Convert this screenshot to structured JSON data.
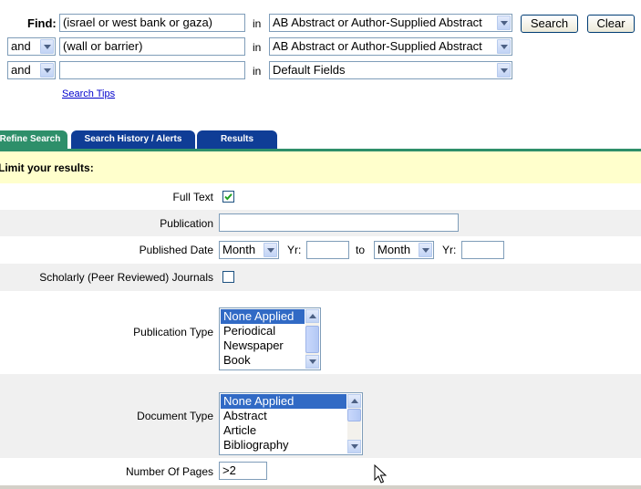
{
  "search": {
    "find_label": "Find:",
    "rows": [
      {
        "op": "",
        "value": "(israel or west bank or gaza)",
        "in_label": "in",
        "field": "AB Abstract or Author-Supplied Abstract"
      },
      {
        "op": "and",
        "value": "(wall or barrier)",
        "in_label": "in",
        "field": "AB Abstract or Author-Supplied Abstract"
      },
      {
        "op": "and",
        "value": "",
        "in_label": "in",
        "field": "Default Fields"
      }
    ],
    "search_button": "Search",
    "clear_button": "Clear",
    "tips_link": "Search Tips"
  },
  "tabs": [
    {
      "label": "Refine Search",
      "active": true
    },
    {
      "label": "Search History / Alerts",
      "active": false
    },
    {
      "label": "Results",
      "active": false
    }
  ],
  "limits": {
    "header": "Limit your results:",
    "full_text": {
      "label": "Full Text",
      "checked": true
    },
    "publication": {
      "label": "Publication",
      "value": ""
    },
    "published_date": {
      "label": "Published Date",
      "from_month": "Month",
      "yr_label": "Yr:",
      "from_year": "",
      "to_label": "to",
      "to_month": "Month",
      "yr_label_2": "Yr:",
      "to_year": ""
    },
    "scholarly": {
      "label": "Scholarly (Peer Reviewed) Journals",
      "checked": false
    },
    "publication_type": {
      "label": "Publication Type",
      "options": [
        "None Applied",
        "Periodical",
        "Newspaper",
        "Book"
      ],
      "selected": "None Applied"
    },
    "document_type": {
      "label": "Document Type",
      "options": [
        "None Applied",
        "Abstract",
        "Article",
        "Bibliography"
      ],
      "selected": "None Applied"
    },
    "number_of_pages": {
      "label": "Number Of Pages",
      "value": ">2"
    }
  },
  "colors": {
    "active_tab": "#2e8f6a",
    "inactive_tab": "#0f3d96",
    "rule": "#2e8f6a",
    "header_band": "#ffffcc",
    "alt_row": "#f0f0f0",
    "selection": "#316ac5"
  }
}
